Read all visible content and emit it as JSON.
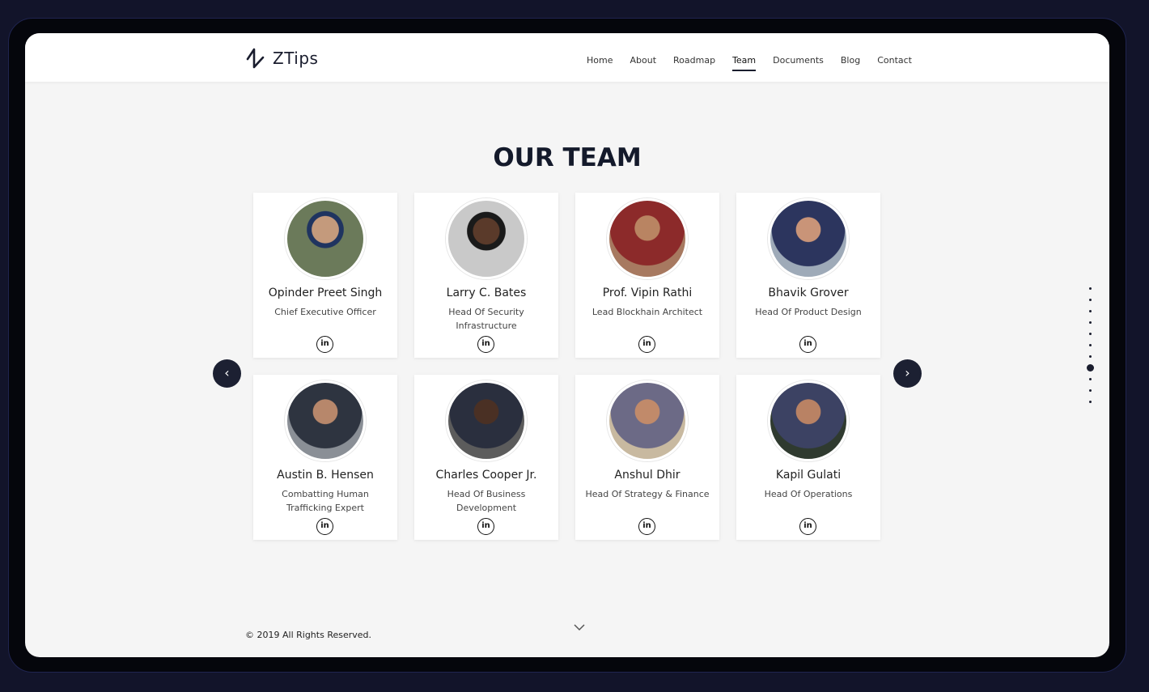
{
  "brand": {
    "name": "ZTips"
  },
  "nav": {
    "items": [
      "Home",
      "About",
      "Roadmap",
      "Team",
      "Documents",
      "Blog",
      "Contact"
    ],
    "active": "Team"
  },
  "section": {
    "title": "OUR TEAM"
  },
  "team": [
    {
      "name": "Opinder Preet Singh",
      "role": "Chief Executive Officer",
      "avatar_color": "#5b6b7a"
    },
    {
      "name": "Larry C. Bates",
      "role": "Head Of Security Infrastructure",
      "avatar_color": "#3b3a3a"
    },
    {
      "name": "Prof. Vipin Rathi",
      "role": "Lead Blockhain Architect",
      "avatar_color": "#8c2a2a"
    },
    {
      "name": "Bhavik Grover",
      "role": "Head Of Product Design",
      "avatar_color": "#2c355e"
    },
    {
      "name": "Austin B. Hensen",
      "role": "Combatting Human Trafficking Expert",
      "avatar_color": "#2e3440"
    },
    {
      "name": "Charles Cooper Jr.",
      "role": "Head Of Business Development",
      "avatar_color": "#3a2f2a"
    },
    {
      "name": "Anshul Dhir",
      "role": "Head Of Strategy & Finance",
      "avatar_color": "#6c6a86"
    },
    {
      "name": "Kapil Gulati",
      "role": "Head Of Operations",
      "avatar_color": "#3c4263"
    }
  ],
  "linkedin": {
    "label": "in",
    "icon": "linkedin-icon"
  },
  "carousel": {
    "prev_icon": "‹",
    "next_icon": "›"
  },
  "pagination": {
    "count": 11,
    "active_index": 7
  },
  "footer": {
    "copyright": "© 2019 All Rights Reserved."
  },
  "colors": {
    "background": "#12142a",
    "accent": "#1a1d2e",
    "surface": "#f5f5f5"
  }
}
